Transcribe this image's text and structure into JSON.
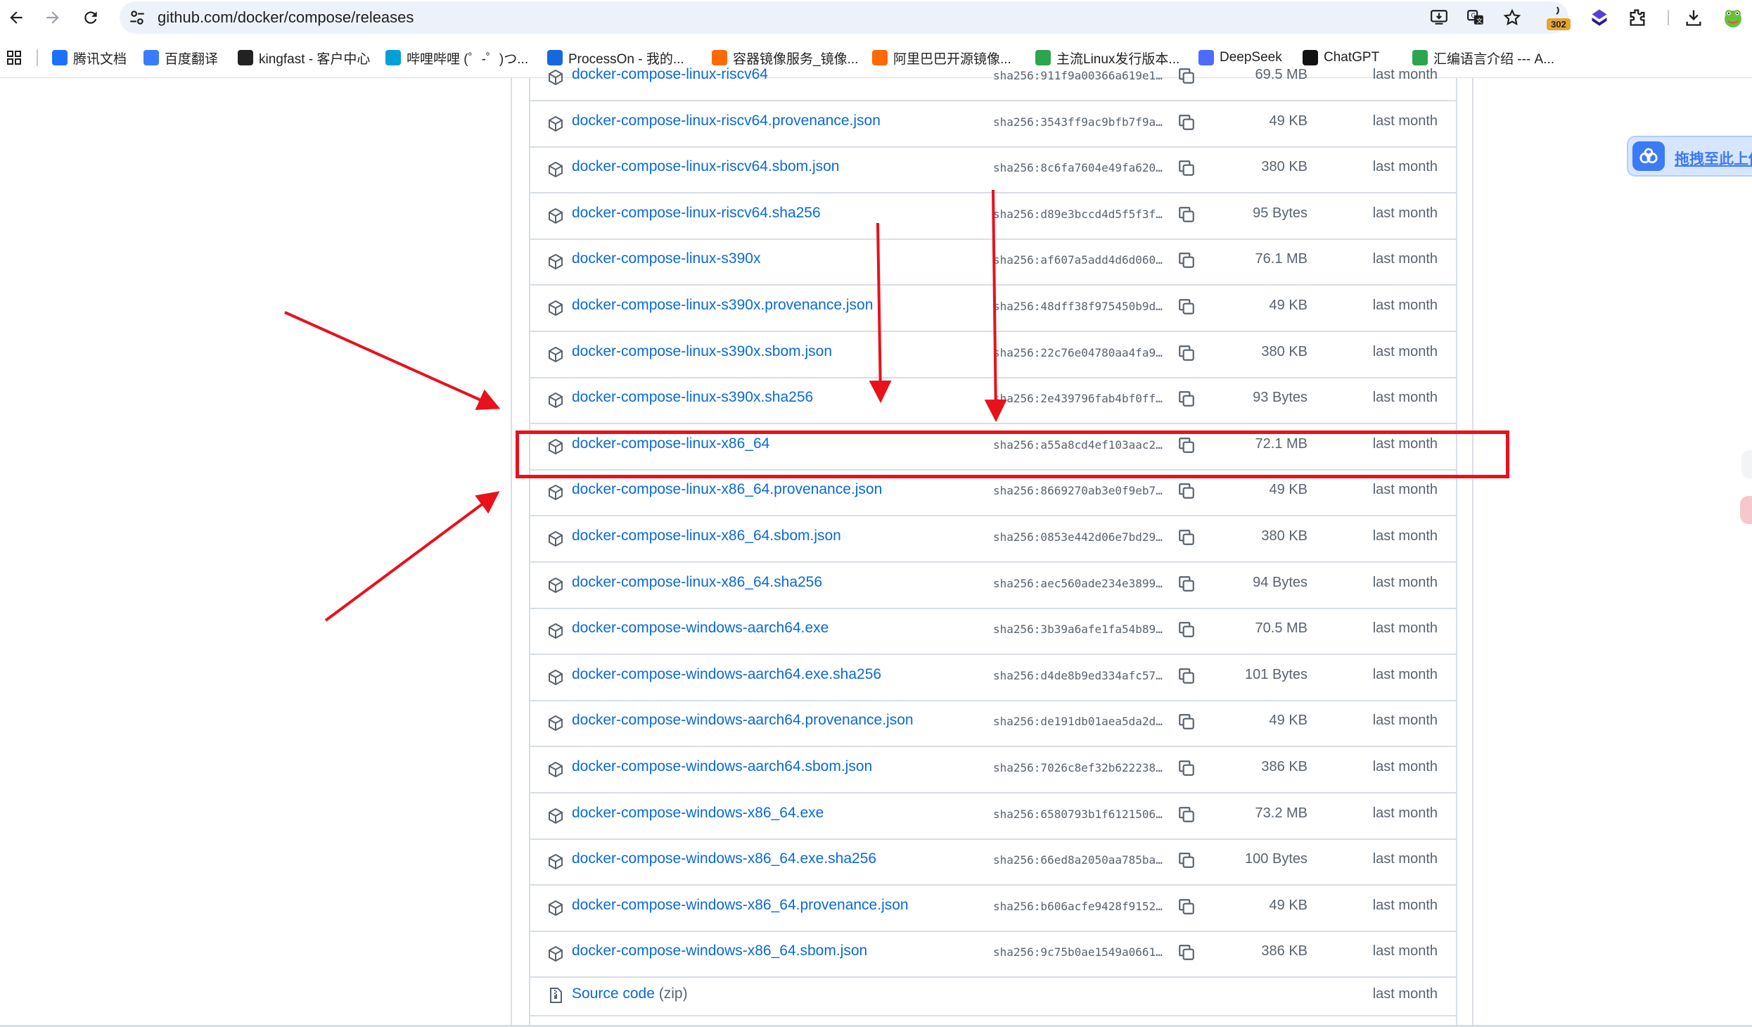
{
  "browser": {
    "url": "github.com/docker/compose/releases",
    "extension_badge": "302"
  },
  "bookmarks": [
    {
      "label": "腾讯文档",
      "icon": "tencent-docs-icon",
      "color": "#1e6fff"
    },
    {
      "label": "百度翻译",
      "icon": "baidu-translate-icon",
      "color": "#3b7cff"
    },
    {
      "label": "kingfast - 客户中心",
      "icon": "cursor-icon",
      "color": "#222222"
    },
    {
      "label": "哔哩哔哩 (゜-゜)つ...",
      "icon": "bilibili-icon",
      "color": "#00a1d6"
    },
    {
      "label": "ProcessOn - 我的...",
      "icon": "processon-icon",
      "color": "#1668dc"
    },
    {
      "label": "容器镜像服务_镜像...",
      "icon": "aliyun-icon",
      "color": "#ff6a00"
    },
    {
      "label": "阿里巴巴开源镜像...",
      "icon": "aliyun-icon",
      "color": "#ff6a00"
    },
    {
      "label": "主流Linux发行版本...",
      "icon": "linux-icon",
      "color": "#2da44e"
    },
    {
      "label": "DeepSeek",
      "icon": "deepseek-icon",
      "color": "#4d6bfe"
    },
    {
      "label": "ChatGPT",
      "icon": "chatgpt-icon",
      "color": "#111111"
    },
    {
      "label": "汇编语言介绍 --- A...",
      "icon": "asm-icon",
      "color": "#2da44e"
    }
  ],
  "assets": [
    {
      "name": "docker-compose-linux-riscv64",
      "sha": "sha256:911f9a00366a619e1…",
      "size": "69.5 MB",
      "date": "last month"
    },
    {
      "name": "docker-compose-linux-riscv64.provenance.json",
      "sha": "sha256:3543ff9ac9bfb7f9a…",
      "size": "49 KB",
      "date": "last month"
    },
    {
      "name": "docker-compose-linux-riscv64.sbom.json",
      "sha": "sha256:8c6fa7604e49fa620…",
      "size": "380 KB",
      "date": "last month"
    },
    {
      "name": "docker-compose-linux-riscv64.sha256",
      "sha": "sha256:d89e3bccd4d5f5f3f…",
      "size": "95 Bytes",
      "date": "last month"
    },
    {
      "name": "docker-compose-linux-s390x",
      "sha": "sha256:af607a5add4d6d060…",
      "size": "76.1 MB",
      "date": "last month"
    },
    {
      "name": "docker-compose-linux-s390x.provenance.json",
      "sha": "sha256:48dff38f975450b9d…",
      "size": "49 KB",
      "date": "last month"
    },
    {
      "name": "docker-compose-linux-s390x.sbom.json",
      "sha": "sha256:22c76e04780aa4fa9…",
      "size": "380 KB",
      "date": "last month"
    },
    {
      "name": "docker-compose-linux-s390x.sha256",
      "sha": "sha256:2e439796fab4bf0ff…",
      "size": "93 Bytes",
      "date": "last month"
    },
    {
      "name": "docker-compose-linux-x86_64",
      "sha": "sha256:a55a8cd4ef103aac2…",
      "size": "72.1 MB",
      "date": "last month"
    },
    {
      "name": "docker-compose-linux-x86_64.provenance.json",
      "sha": "sha256:8669270ab3e0f9eb7…",
      "size": "49 KB",
      "date": "last month"
    },
    {
      "name": "docker-compose-linux-x86_64.sbom.json",
      "sha": "sha256:0853e442d06e7bd29…",
      "size": "380 KB",
      "date": "last month"
    },
    {
      "name": "docker-compose-linux-x86_64.sha256",
      "sha": "sha256:aec560ade234e3899…",
      "size": "94 Bytes",
      "date": "last month"
    },
    {
      "name": "docker-compose-windows-aarch64.exe",
      "sha": "sha256:3b39a6afe1fa54b89…",
      "size": "70.5 MB",
      "date": "last month"
    },
    {
      "name": "docker-compose-windows-aarch64.exe.sha256",
      "sha": "sha256:d4de8b9ed334afc57…",
      "size": "101 Bytes",
      "date": "last month"
    },
    {
      "name": "docker-compose-windows-aarch64.provenance.json",
      "sha": "sha256:de191db01aea5da2d…",
      "size": "49 KB",
      "date": "last month"
    },
    {
      "name": "docker-compose-windows-aarch64.sbom.json",
      "sha": "sha256:7026c8ef32b622238…",
      "size": "386 KB",
      "date": "last month"
    },
    {
      "name": "docker-compose-windows-x86_64.exe",
      "sha": "sha256:6580793b1f6121506…",
      "size": "73.2 MB",
      "date": "last month"
    },
    {
      "name": "docker-compose-windows-x86_64.exe.sha256",
      "sha": "sha256:66ed8a2050aa785ba…",
      "size": "100 Bytes",
      "date": "last month"
    },
    {
      "name": "docker-compose-windows-x86_64.provenance.json",
      "sha": "sha256:b606acfe9428f9152…",
      "size": "49 KB",
      "date": "last month"
    },
    {
      "name": "docker-compose-windows-x86_64.sbom.json",
      "sha": "sha256:9c75b0ae1549a0661…",
      "size": "386 KB",
      "date": "last month"
    }
  ],
  "source_code": {
    "label": "Source code",
    "format": "(zip)",
    "date": "last month"
  },
  "highlighted_asset": "docker-compose-linux-x86_64",
  "annotation_color": "#e8111c",
  "link_color": "#0969da",
  "baidu_widget": {
    "label": "拖拽至此上传"
  }
}
